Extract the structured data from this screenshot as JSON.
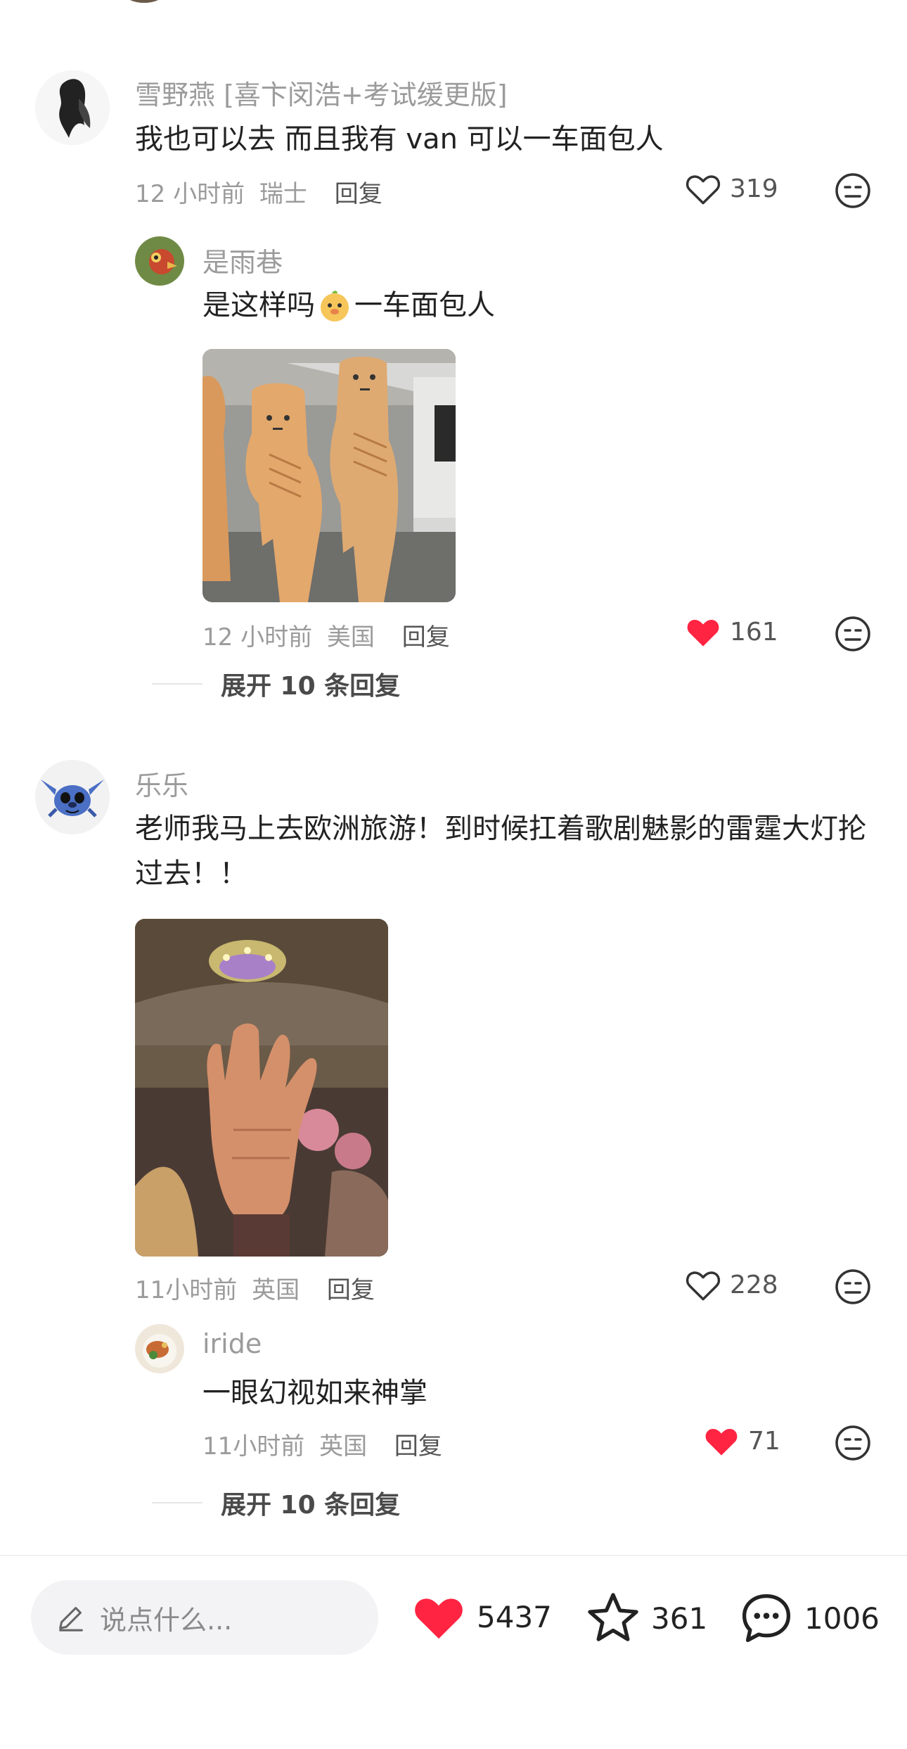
{
  "comments": [
    {
      "user": "雪野燕 [喜卞闵浩+考试缓更版]",
      "text": "我也可以去 而且我有 van 可以一车面包人",
      "time": "12 小时前",
      "location": "瑞士",
      "reply_label": "回复",
      "likes": "319",
      "liked": false,
      "avatar_icon": "avatar-woman-sketch-icon",
      "replies": [
        {
          "user": "是雨巷",
          "text_before": "是这样吗",
          "emoji": "happy-duck-emoji-icon",
          "text_after": "一车面包人",
          "time": "12 小时前",
          "location": "美国",
          "reply_label": "回复",
          "likes": "161",
          "liked": true,
          "avatar_icon": "avatar-bird-icon",
          "image_icon": "bread-costume-people-photo"
        }
      ],
      "expand_label": "展开 10 条回复"
    },
    {
      "user": "乐乐",
      "text": "老师我马上去欧洲旅游！到时候扛着歌剧魅影的雷霆大灯抡过去！！",
      "time": "11小时前",
      "location": "英国",
      "reply_label": "回复",
      "likes": "228",
      "liked": false,
      "avatar_icon": "avatar-stitch-icon",
      "image_icon": "theater-hand-chandelier-photo",
      "replies": [
        {
          "user": "iride",
          "text": "一眼幻视如来神掌",
          "time": "11小时前",
          "location": "英国",
          "reply_label": "回复",
          "likes": "71",
          "liked": true,
          "avatar_icon": "avatar-food-icon"
        }
      ],
      "expand_label": "展开 10 条回复"
    }
  ],
  "bottom_bar": {
    "input_placeholder": "说点什么...",
    "likes": "5437",
    "stars": "361",
    "comments": "1006"
  },
  "colors": {
    "like_red": "#ff2442",
    "muted": "#9b9b9b"
  }
}
